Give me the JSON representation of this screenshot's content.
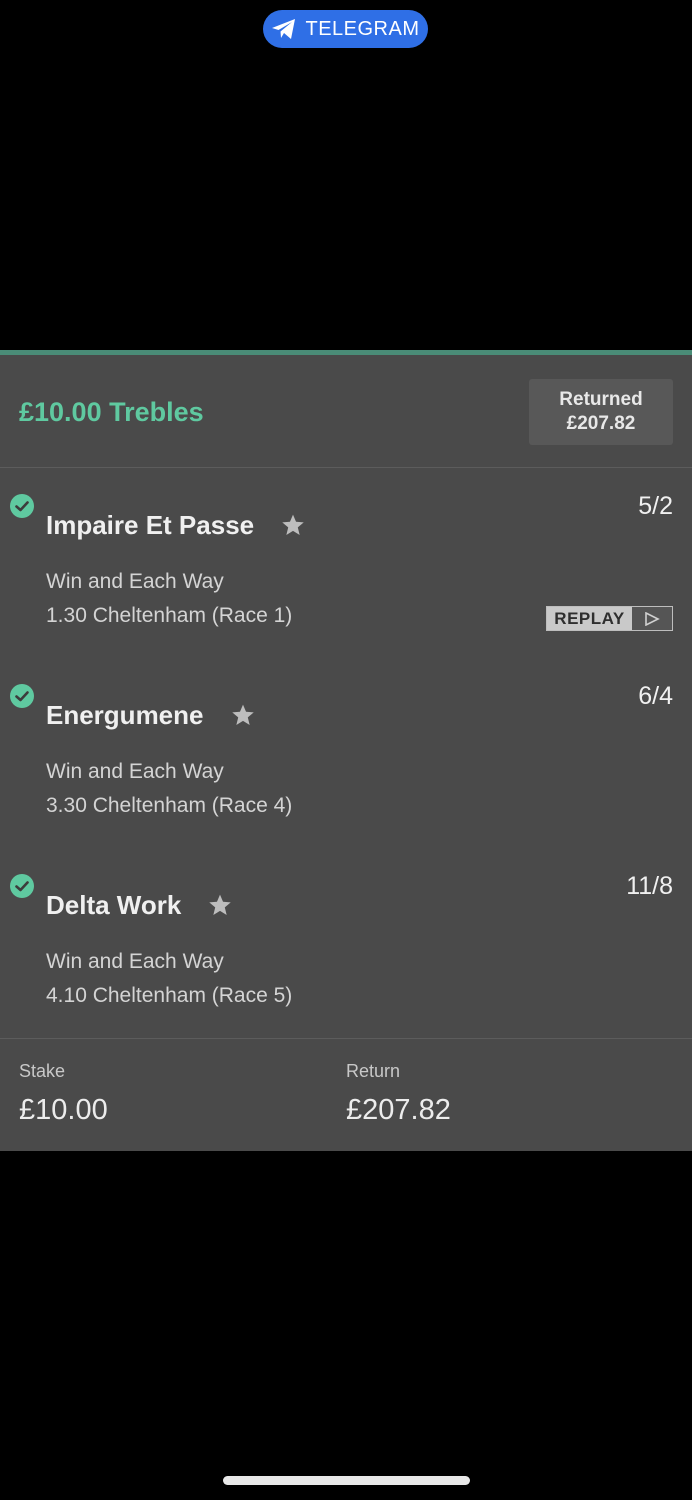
{
  "banner": {
    "label": "TELEGRAM",
    "icon": "telegram-plane-icon",
    "color": "#2f6fe6"
  },
  "bet": {
    "title": "£10.00 Trebles",
    "accent_color": "#5fc9a0",
    "returned_label": "Returned",
    "returned_amount": "£207.82"
  },
  "selections": [
    {
      "name": "Impaire Et Passe",
      "odds": "5/2",
      "market": "Win and Each Way",
      "race": "1.30 Cheltenham (Race 1)",
      "status_icon": "check-circle-icon",
      "has_replay": true
    },
    {
      "name": "Energumene",
      "odds": "6/4",
      "market": "Win and Each Way",
      "race": "3.30 Cheltenham (Race 4)",
      "status_icon": "check-circle-icon",
      "has_replay": false
    },
    {
      "name": "Delta Work",
      "odds": "11/8",
      "market": "Win and Each Way",
      "race": "4.10 Cheltenham (Race 5)",
      "status_icon": "check-circle-icon",
      "has_replay": false
    }
  ],
  "replay": {
    "label": "REPLAY"
  },
  "footer": {
    "stake_label": "Stake",
    "stake_value": "£10.00",
    "return_label": "Return",
    "return_value": "£207.82"
  }
}
